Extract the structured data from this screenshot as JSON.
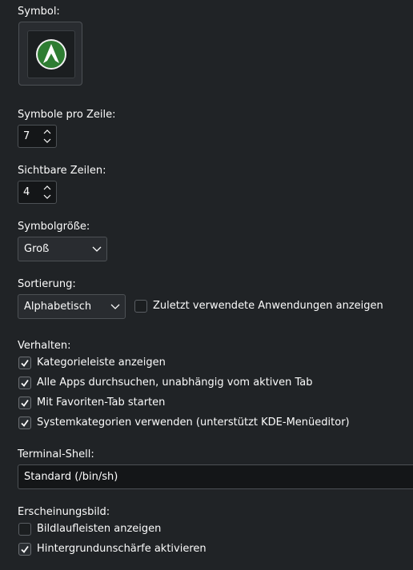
{
  "symbol": {
    "label": "Symbol:",
    "icon": "arch-linux-logo-icon",
    "accent": "#2e7d32"
  },
  "icons_per_row": {
    "label": "Symbole pro Zeile:",
    "value": "7"
  },
  "visible_rows": {
    "label": "Sichtbare Zeilen:",
    "value": "4"
  },
  "icon_size": {
    "label": "Symbolgröße:",
    "selected": "Groß"
  },
  "sorting": {
    "label": "Sortierung:",
    "selected": "Alphabetisch",
    "recent_apps": {
      "label": "Zuletzt verwendete Anwendungen anzeigen",
      "checked": false
    }
  },
  "behavior": {
    "label": "Verhalten:",
    "options": [
      {
        "label": "Kategorieleiste anzeigen",
        "checked": true
      },
      {
        "label": "Alle Apps durchsuchen, unabhängig vom aktiven Tab",
        "checked": true
      },
      {
        "label": "Mit Favoriten-Tab starten",
        "checked": true
      },
      {
        "label": "Systemkategorien verwenden (unterstützt KDE-Menüeditor)",
        "checked": true
      }
    ]
  },
  "terminal": {
    "label": "Terminal-Shell:",
    "value": "Standard (/bin/sh)"
  },
  "appearance": {
    "label": "Erscheinungsbild:",
    "options": [
      {
        "label": "Bildlaufleisten anzeigen",
        "checked": false
      },
      {
        "label": "Hintergrundunschärfe aktivieren",
        "checked": true
      }
    ]
  },
  "colors": {
    "background": "#202326",
    "text": "#fcfcfc",
    "border": "#4d5155"
  }
}
